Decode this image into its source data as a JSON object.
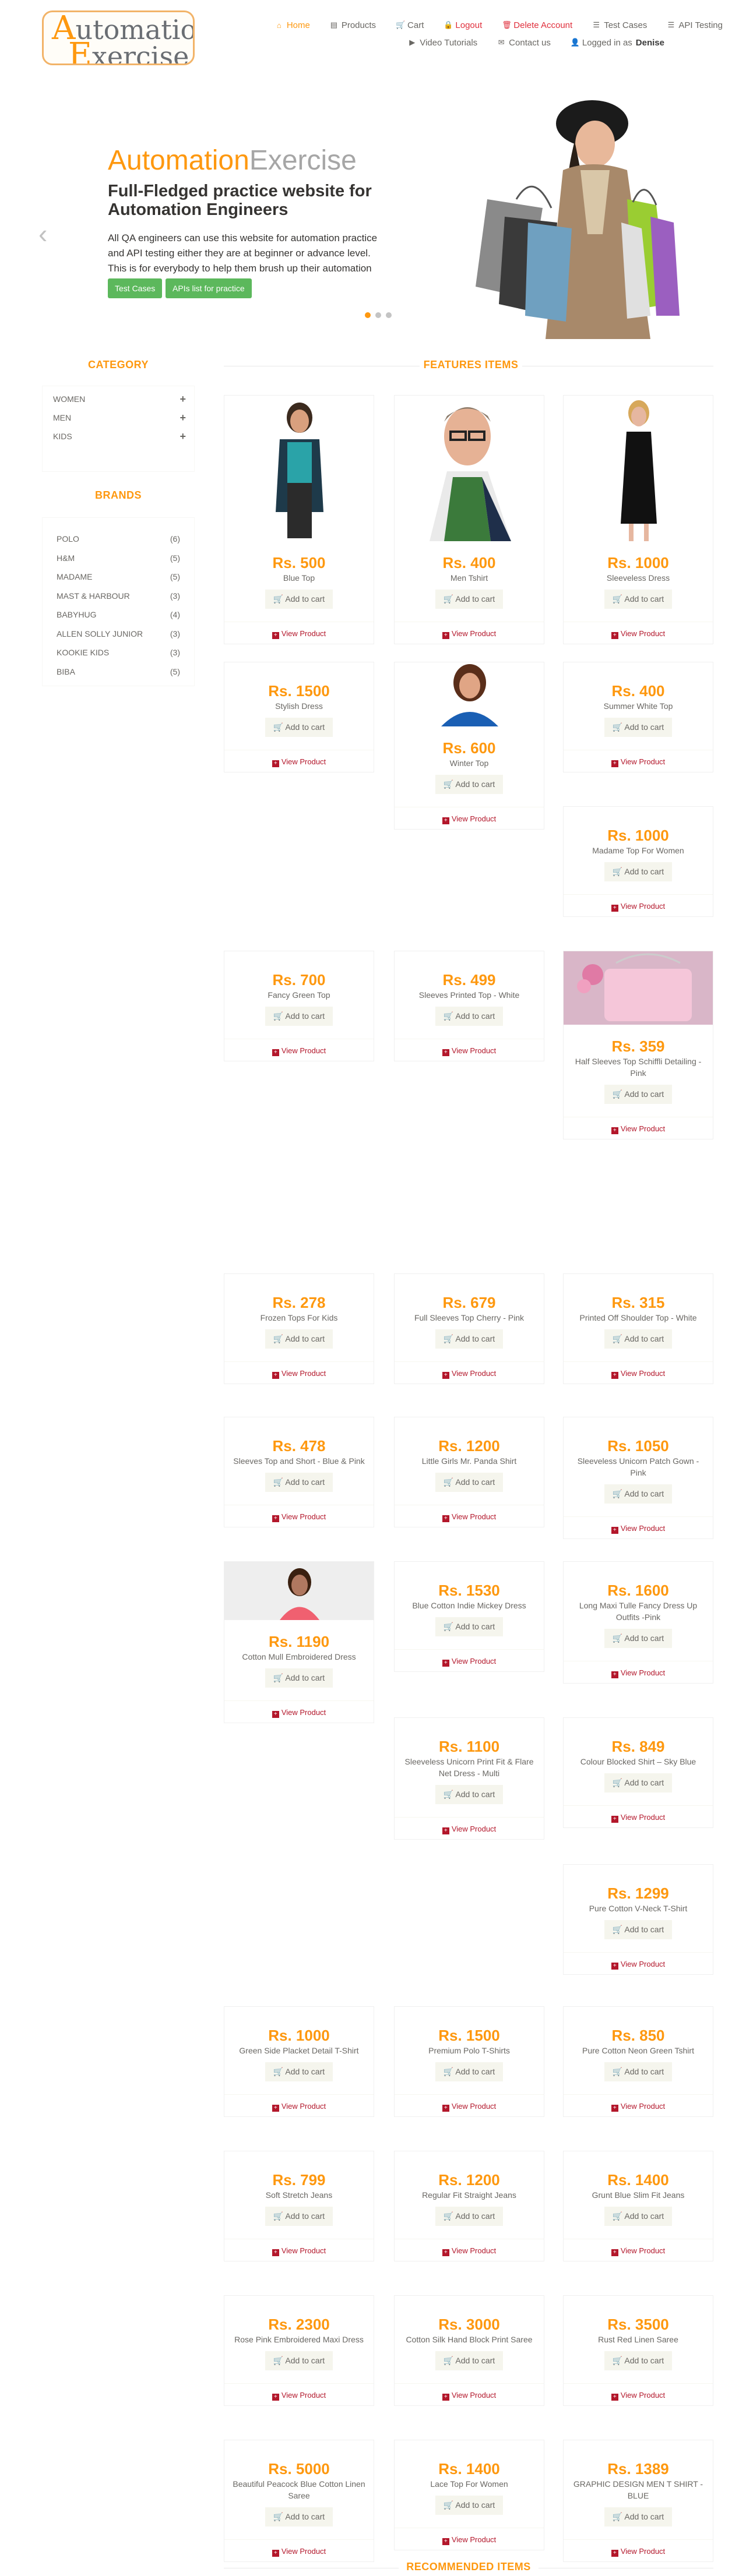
{
  "logo": {
    "line1_a": "A",
    "line1_b": "utomation",
    "line2_a": "E",
    "line2_b": "xercise"
  },
  "nav": {
    "row1": [
      {
        "icon": "home-icon",
        "glyph": "⌂",
        "label": "Home",
        "style": "active"
      },
      {
        "icon": "store-icon",
        "glyph": "▤",
        "label": "Products",
        "style": ""
      },
      {
        "icon": "cart-icon",
        "glyph": "🛒",
        "label": "Cart",
        "style": ""
      },
      {
        "icon": "lock-icon",
        "glyph": "🔒",
        "label": "Logout",
        "style": "red"
      },
      {
        "icon": "trash-icon",
        "glyph": "🗑",
        "label": "Delete Account",
        "style": "red"
      },
      {
        "icon": "list-icon",
        "glyph": "☰",
        "label": "Test Cases",
        "style": ""
      },
      {
        "icon": "list-icon",
        "glyph": "☰",
        "label": "API Testing",
        "style": ""
      }
    ],
    "row2": [
      {
        "icon": "youtube-icon",
        "glyph": "▶",
        "label": "Video Tutorials"
      },
      {
        "icon": "envelope-icon",
        "glyph": "✉",
        "label": "Contact us"
      }
    ],
    "logged_prefix": "Logged in as",
    "logged_user": "Denise"
  },
  "slider": {
    "title_a": "Automation",
    "title_b": "Exercise",
    "subtitle": "Full-Fledged practice website for Automation Engineers",
    "text": "All QA engineers can use this website for automation practice and API testing either they are at beginner or advance level. This is for everybody to help them brush up their automation skills.",
    "btn_test": "Test Cases",
    "btn_api": "APIs list for practice",
    "arrow_left": "‹",
    "arrow_right": "›"
  },
  "sidebar": {
    "category_title": "CATEGORY",
    "categories": [
      {
        "label": "WOMEN",
        "toggle": "+"
      },
      {
        "label": "MEN",
        "toggle": "+"
      },
      {
        "label": "KIDS",
        "toggle": "+"
      }
    ],
    "brands_title": "BRANDS",
    "brands": [
      {
        "name": "POLO",
        "count": "(6)"
      },
      {
        "name": "H&M",
        "count": "(5)"
      },
      {
        "name": "MADAME",
        "count": "(5)"
      },
      {
        "name": "MAST & HARBOUR",
        "count": "(3)"
      },
      {
        "name": "BABYHUG",
        "count": "(4)"
      },
      {
        "name": "ALLEN SOLLY JUNIOR",
        "count": "(3)"
      },
      {
        "name": "KOOKIE KIDS",
        "count": "(3)"
      },
      {
        "name": "BIBA",
        "count": "(5)"
      }
    ]
  },
  "features_title": "FEATURES ITEMS",
  "recommended_title": "RECOMMENDED ITEMS",
  "cart_label": "Add to cart",
  "view_label": "View Product",
  "products": [
    {
      "price": "Rs. 500",
      "name": "Blue Top"
    },
    {
      "price": "Rs. 400",
      "name": "Men Tshirt"
    },
    {
      "price": "Rs. 1000",
      "name": "Sleeveless Dress"
    },
    {
      "price": "Rs. 1500",
      "name": "Stylish Dress"
    },
    {
      "price": "Rs. 600",
      "name": "Winter Top"
    },
    {
      "price": "Rs. 400",
      "name": "Summer White Top"
    },
    {
      "price": "Rs. 1000",
      "name": "Madame Top For Women"
    },
    {
      "price": "Rs. 700",
      "name": "Fancy Green Top"
    },
    {
      "price": "Rs. 499",
      "name": "Sleeves Printed Top - White"
    },
    {
      "price": "Rs. 359",
      "name": "Half Sleeves Top Schiffli Detailing - Pink"
    },
    {
      "price": "Rs. 278",
      "name": "Frozen Tops For Kids"
    },
    {
      "price": "Rs. 679",
      "name": "Full Sleeves Top Cherry - Pink"
    },
    {
      "price": "Rs. 315",
      "name": "Printed Off Shoulder Top - White"
    },
    {
      "price": "Rs. 478",
      "name": "Sleeves Top and Short - Blue & Pink"
    },
    {
      "price": "Rs. 1200",
      "name": "Little Girls Mr. Panda Shirt"
    },
    {
      "price": "Rs. 1050",
      "name": "Sleeveless Unicorn Patch Gown - Pink"
    },
    {
      "price": "Rs. 1190",
      "name": "Cotton Mull Embroidered Dress"
    },
    {
      "price": "Rs. 1530",
      "name": "Blue Cotton Indie Mickey Dress"
    },
    {
      "price": "Rs. 1600",
      "name": "Long Maxi Tulle Fancy Dress Up Outfits -Pink"
    },
    {
      "price": "Rs. 1100",
      "name": "Sleeveless Unicorn Print Fit & Flare Net Dress - Multi"
    },
    {
      "price": "Rs. 849",
      "name": "Colour Blocked Shirt – Sky Blue"
    },
    {
      "price": "Rs. 1299",
      "name": "Pure Cotton V-Neck T-Shirt"
    },
    {
      "price": "Rs. 1000",
      "name": "Green Side Placket Detail T-Shirt"
    },
    {
      "price": "Rs. 1500",
      "name": "Premium Polo T-Shirts"
    },
    {
      "price": "Rs. 850",
      "name": "Pure Cotton Neon Green Tshirt"
    },
    {
      "price": "Rs. 799",
      "name": "Soft Stretch Jeans"
    },
    {
      "price": "Rs. 1200",
      "name": "Regular Fit Straight Jeans"
    },
    {
      "price": "Rs. 1400",
      "name": "Grunt Blue Slim Fit Jeans"
    },
    {
      "price": "Rs. 2300",
      "name": "Rose Pink Embroidered Maxi Dress"
    },
    {
      "price": "Rs. 3000",
      "name": "Cotton Silk Hand Block Print Saree"
    },
    {
      "price": "Rs. 3500",
      "name": "Rust Red Linen Saree"
    },
    {
      "price": "Rs. 5000",
      "name": "Beautiful Peacock Blue Cotton Linen Saree"
    },
    {
      "price": "Rs. 1400",
      "name": "Lace Top For Women"
    },
    {
      "price": "Rs. 1389",
      "name": "GRAPHIC DESIGN MEN T SHIRT - BLUE"
    }
  ]
}
